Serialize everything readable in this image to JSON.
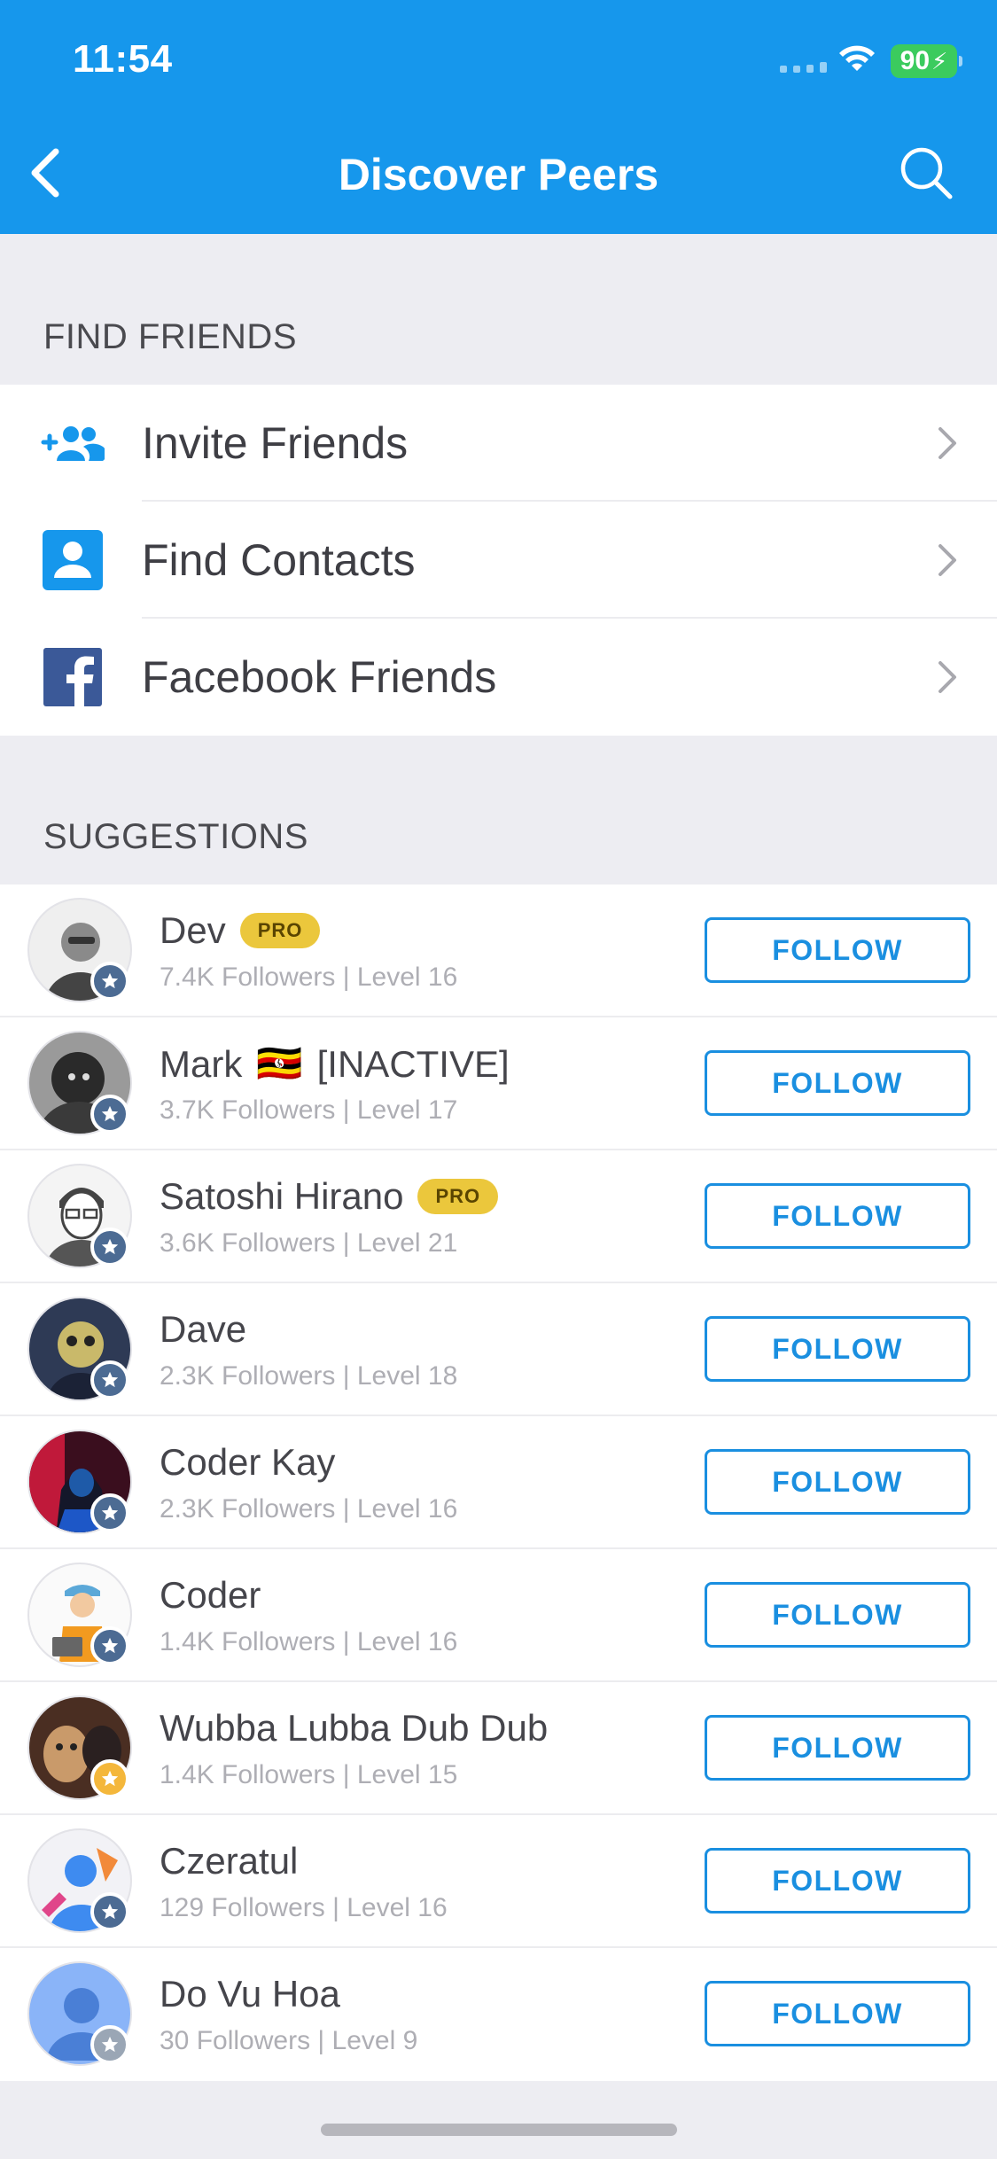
{
  "status_bar": {
    "time": "11:54",
    "battery": "90"
  },
  "nav": {
    "title": "Discover Peers",
    "back_icon": "chevron-left-icon",
    "search_icon": "search-icon"
  },
  "find_friends": {
    "header": "FIND FRIENDS",
    "items": [
      {
        "label": "Invite Friends",
        "icon": "add-people-icon"
      },
      {
        "label": "Find Contacts",
        "icon": "contact-card-icon"
      },
      {
        "label": "Facebook Friends",
        "icon": "facebook-icon"
      }
    ]
  },
  "suggestions": {
    "header": "SUGGESTIONS",
    "follow_label": "FOLLOW",
    "pro_label": "PRO",
    "users": [
      {
        "name": "Dev",
        "pro": true,
        "meta": "7.4K Followers | Level 16"
      },
      {
        "name": "Mark",
        "flag": "🇺🇬",
        "status": "[INACTIVE]",
        "meta": "3.7K Followers | Level 17"
      },
      {
        "name": "Satoshi Hirano",
        "pro": true,
        "meta": "3.6K Followers | Level 21"
      },
      {
        "name": "Dave",
        "meta": "2.3K Followers | Level 18"
      },
      {
        "name": "Coder Kay",
        "meta": "2.3K Followers | Level 16"
      },
      {
        "name": "Coder",
        "meta": "1.4K Followers | Level 16"
      },
      {
        "name": "Wubba Lubba Dub Dub",
        "meta": "1.4K Followers | Level 15"
      },
      {
        "name": "Czeratul",
        "meta": "129 Followers | Level 16"
      },
      {
        "name": "Do Vu Hoa",
        "meta": "30 Followers | Level 9"
      }
    ]
  },
  "colors": {
    "brand": "#1697EC",
    "follow": "#1A8FE0",
    "pro": "#EBC73C",
    "background": "#EDEDF2"
  }
}
